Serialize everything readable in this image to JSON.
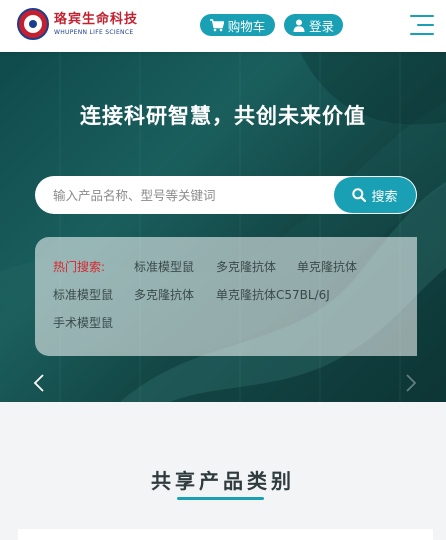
{
  "header": {
    "logo_cn": "珞宾生命科技",
    "logo_en": "WHUPENN LIFE SCIENCE",
    "cart_label": "购物车",
    "login_label": "登录"
  },
  "hero": {
    "title": "连接科研智慧，共创未来价值",
    "search_placeholder": "输入产品名称、型号等关键词",
    "search_button": "搜索",
    "hot_label": "热门搜索:",
    "hot_terms": [
      "标准模型鼠",
      "多克隆抗体",
      "单克隆抗体",
      "标准模型鼠",
      "多克隆抗体",
      "单克隆抗体C57BL/6J",
      "手术模型鼠"
    ]
  },
  "section": {
    "title": "共享产品类别"
  },
  "colors": {
    "accent": "#1aa0b4",
    "brand_red": "#c4202f",
    "brand_blue": "#1d3e8f",
    "hot_red": "#d9262d"
  },
  "icons": [
    "cart-icon",
    "user-icon",
    "menu-icon",
    "search-icon",
    "chevron-left-icon",
    "chevron-right-icon"
  ]
}
